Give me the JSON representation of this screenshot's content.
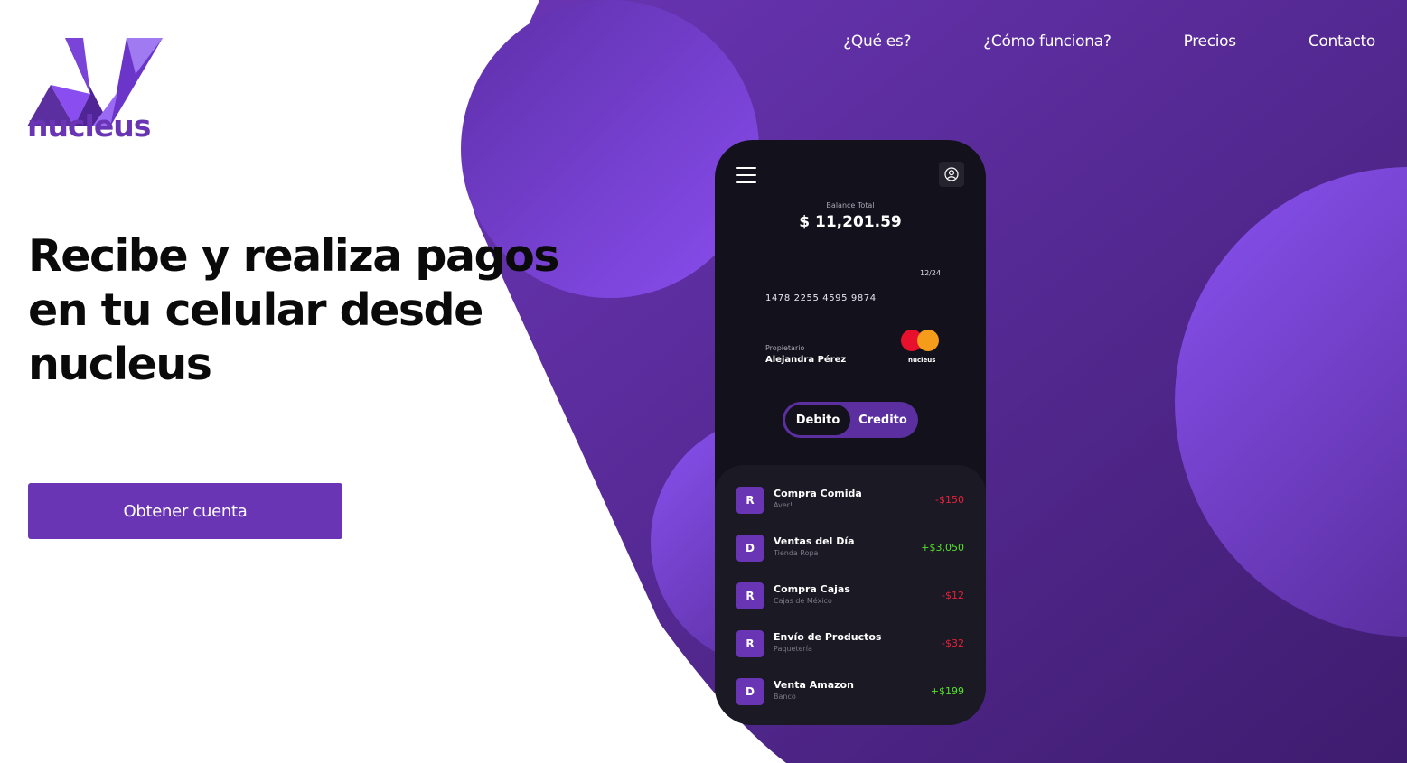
{
  "brand": {
    "name": "nucleus"
  },
  "nav": {
    "items": [
      "¿Qué es?",
      "¿Cómo funciona?",
      "Precios",
      "Contacto"
    ]
  },
  "hero": {
    "title": "Recibe y realiza pagos en tu celular desde nucleus",
    "cta_label": "Obtener cuenta"
  },
  "phone": {
    "menu_icon": "hamburger-menu-icon",
    "profile_icon": "user-icon",
    "balance_label": "Balance Total",
    "balance_value": "$ 11,201.59",
    "card": {
      "expiry": "12/24",
      "number": "1478 2255 4595 9874",
      "owner_label": "Propietario",
      "owner_name": "Alejandra Pérez",
      "brand_logo": "mastercard-icon",
      "brand_text": "nucleus"
    },
    "toggle": {
      "debit": "Debito",
      "credit": "Credito",
      "selected": "Debito"
    },
    "transactions": [
      {
        "badge": "R",
        "title": "Compra Comida",
        "subtitle": "Aver!",
        "amount": "-$150",
        "type": "negative"
      },
      {
        "badge": "D",
        "title": "Ventas del Día",
        "subtitle": "Tienda Ropa",
        "amount": "+$3,050",
        "type": "positive"
      },
      {
        "badge": "R",
        "title": "Compra Cajas",
        "subtitle": "Cajas de México",
        "amount": "-$12",
        "type": "negative"
      },
      {
        "badge": "R",
        "title": "Envío de Productos",
        "subtitle": "Paquetería",
        "amount": "-$32",
        "type": "negative"
      },
      {
        "badge": "D",
        "title": "Venta Amazon",
        "subtitle": "Banco",
        "amount": "+$199",
        "type": "positive"
      }
    ]
  },
  "colors": {
    "brand_purple": "#6a35b5",
    "bg_purple": "#5b2fa0",
    "phone_bg": "#13121c",
    "negative": "#e8223a",
    "positive": "#55e02c"
  }
}
